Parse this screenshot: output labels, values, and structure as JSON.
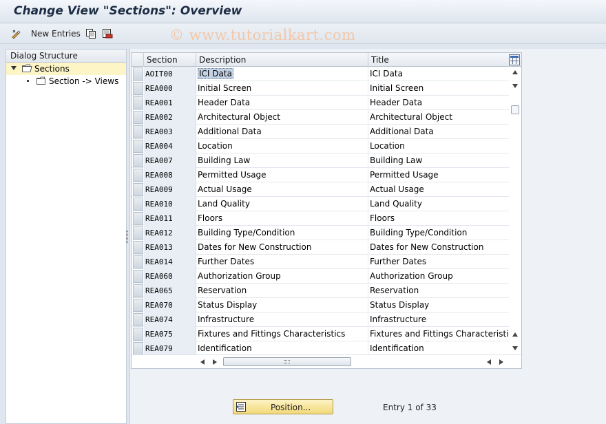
{
  "window": {
    "title": "Change View \"Sections\": Overview"
  },
  "toolbar": {
    "new_entries_label": "New Entries",
    "watermark": "© www.tutorialkart.com"
  },
  "dialog_structure": {
    "header": "Dialog Structure",
    "items": [
      {
        "label": "Sections",
        "expanded": true,
        "selected": true
      },
      {
        "label": "Section -> Views",
        "expanded": false,
        "selected": false
      }
    ]
  },
  "table": {
    "columns": [
      "Section",
      "Description",
      "Title"
    ],
    "rows": [
      {
        "section": "AOIT00",
        "description": "ICI Data",
        "title": "ICI Data"
      },
      {
        "section": "REA000",
        "description": "Initial Screen",
        "title": "Initial Screen"
      },
      {
        "section": "REA001",
        "description": "Header Data",
        "title": "Header Data"
      },
      {
        "section": "REA002",
        "description": "Architectural Object",
        "title": "Architectural Object"
      },
      {
        "section": "REA003",
        "description": "Additional Data",
        "title": "Additional Data"
      },
      {
        "section": "REA004",
        "description": "Location",
        "title": "Location"
      },
      {
        "section": "REA007",
        "description": "Building Law",
        "title": "Building Law"
      },
      {
        "section": "REA008",
        "description": "Permitted Usage",
        "title": "Permitted Usage"
      },
      {
        "section": "REA009",
        "description": "Actual Usage",
        "title": "Actual Usage"
      },
      {
        "section": "REA010",
        "description": "Land Quality",
        "title": "Land Quality"
      },
      {
        "section": "REA011",
        "description": "Floors",
        "title": "Floors"
      },
      {
        "section": "REA012",
        "description": "Building Type/Condition",
        "title": "Building Type/Condition"
      },
      {
        "section": "REA013",
        "description": "Dates for New Construction",
        "title": "Dates for New Construction"
      },
      {
        "section": "REA014",
        "description": "Further Dates",
        "title": "Further Dates"
      },
      {
        "section": "REA060",
        "description": "Authorization Group",
        "title": "Authorization Group"
      },
      {
        "section": "REA065",
        "description": "Reservation",
        "title": "Reservation"
      },
      {
        "section": "REA070",
        "description": "Status Display",
        "title": "Status Display"
      },
      {
        "section": "REA074",
        "description": "Infrastructure",
        "title": "Infrastructure"
      },
      {
        "section": "REA075",
        "description": "Fixtures and Fittings Characteristics",
        "title": "Fixtures and Fittings Characteristics"
      },
      {
        "section": "REA079",
        "description": "Identification",
        "title": "Identification"
      }
    ]
  },
  "footer": {
    "position_label": "Position...",
    "entry_info": "Entry 1 of 33"
  }
}
